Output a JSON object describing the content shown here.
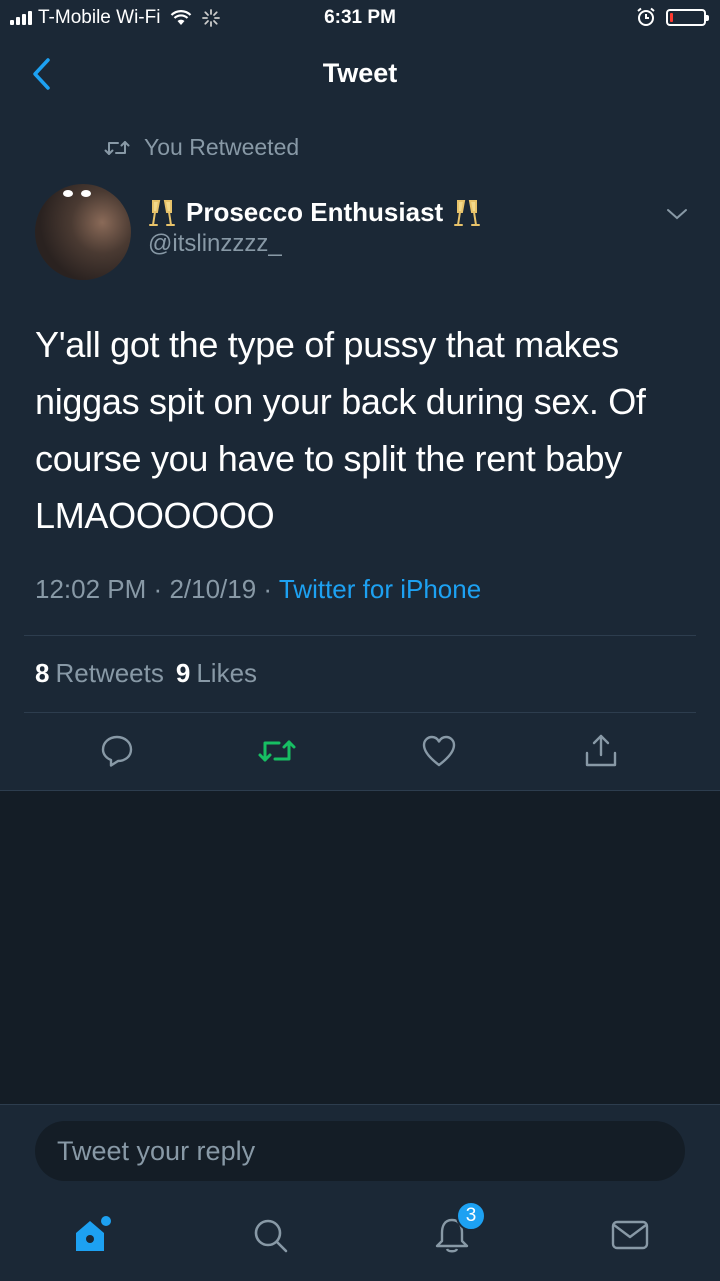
{
  "status_bar": {
    "carrier": "T-Mobile Wi-Fi",
    "time": "6:31 PM",
    "battery_level": 0.1,
    "battery_color": "#ff3b30"
  },
  "nav": {
    "title": "Tweet",
    "back_icon": "chevron-left-icon"
  },
  "tweet": {
    "retweet_context": "You Retweeted",
    "author": {
      "display_name": "Prosecco Enthusiast",
      "handle": "@itslinzzzz_",
      "name_emoji": "champagne-glasses-icon"
    },
    "text": "Y'all got the type of pussy that makes niggas spit on your back during sex. Of course you have to split the rent baby LMAOOOOOO",
    "time": "12:02 PM",
    "date": "2/10/19",
    "separator": "·",
    "source": "Twitter for iPhone",
    "retweet_count": "8",
    "retweet_label": "Retweets",
    "like_count": "9",
    "like_label": "Likes"
  },
  "actions": [
    "reply-icon",
    "retweet-icon",
    "like-icon",
    "share-icon"
  ],
  "reply": {
    "placeholder": "Tweet your reply"
  },
  "tab_bar": {
    "items": [
      "home-icon",
      "search-icon",
      "notifications-icon",
      "messages-icon"
    ],
    "notification_badge": "3"
  },
  "colors": {
    "accent": "#1da1f2",
    "retweet_active": "#17bf63",
    "secondary_text": "#8899a6",
    "background": "#1b2836"
  }
}
